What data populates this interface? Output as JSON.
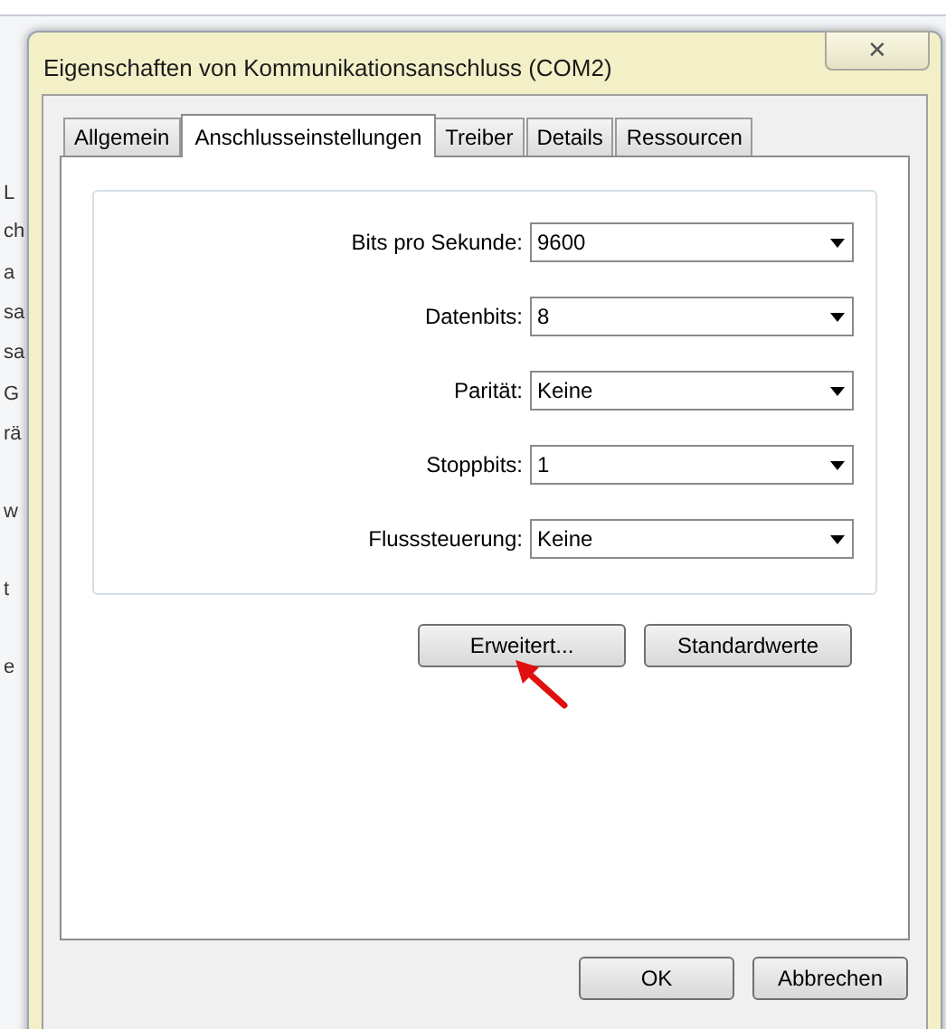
{
  "background_fragments": [
    "L",
    "ch",
    "a",
    "sa",
    "sa",
    "G",
    "rä",
    "w",
    "t",
    "e"
  ],
  "window": {
    "title": "Eigenschaften von Kommunikationsanschluss (COM2)",
    "close": "✕"
  },
  "tabs": [
    {
      "label": "Allgemein",
      "selected": false
    },
    {
      "label": "Anschlusseinstellungen",
      "selected": true
    },
    {
      "label": "Treiber",
      "selected": false
    },
    {
      "label": "Details",
      "selected": false
    },
    {
      "label": "Ressourcen",
      "selected": false
    }
  ],
  "settings": [
    {
      "label": "Bits pro Sekunde:",
      "value": "9600"
    },
    {
      "label": "Datenbits:",
      "value": "8"
    },
    {
      "label": "Parität:",
      "value": "Keine"
    },
    {
      "label": "Stoppbits:",
      "value": "1"
    },
    {
      "label": "Flusssteuerung:",
      "value": "Keine"
    }
  ],
  "panel_buttons": [
    "Erweitert...",
    "Standardwerte"
  ],
  "buttons": [
    "OK",
    "Abbrechen"
  ]
}
